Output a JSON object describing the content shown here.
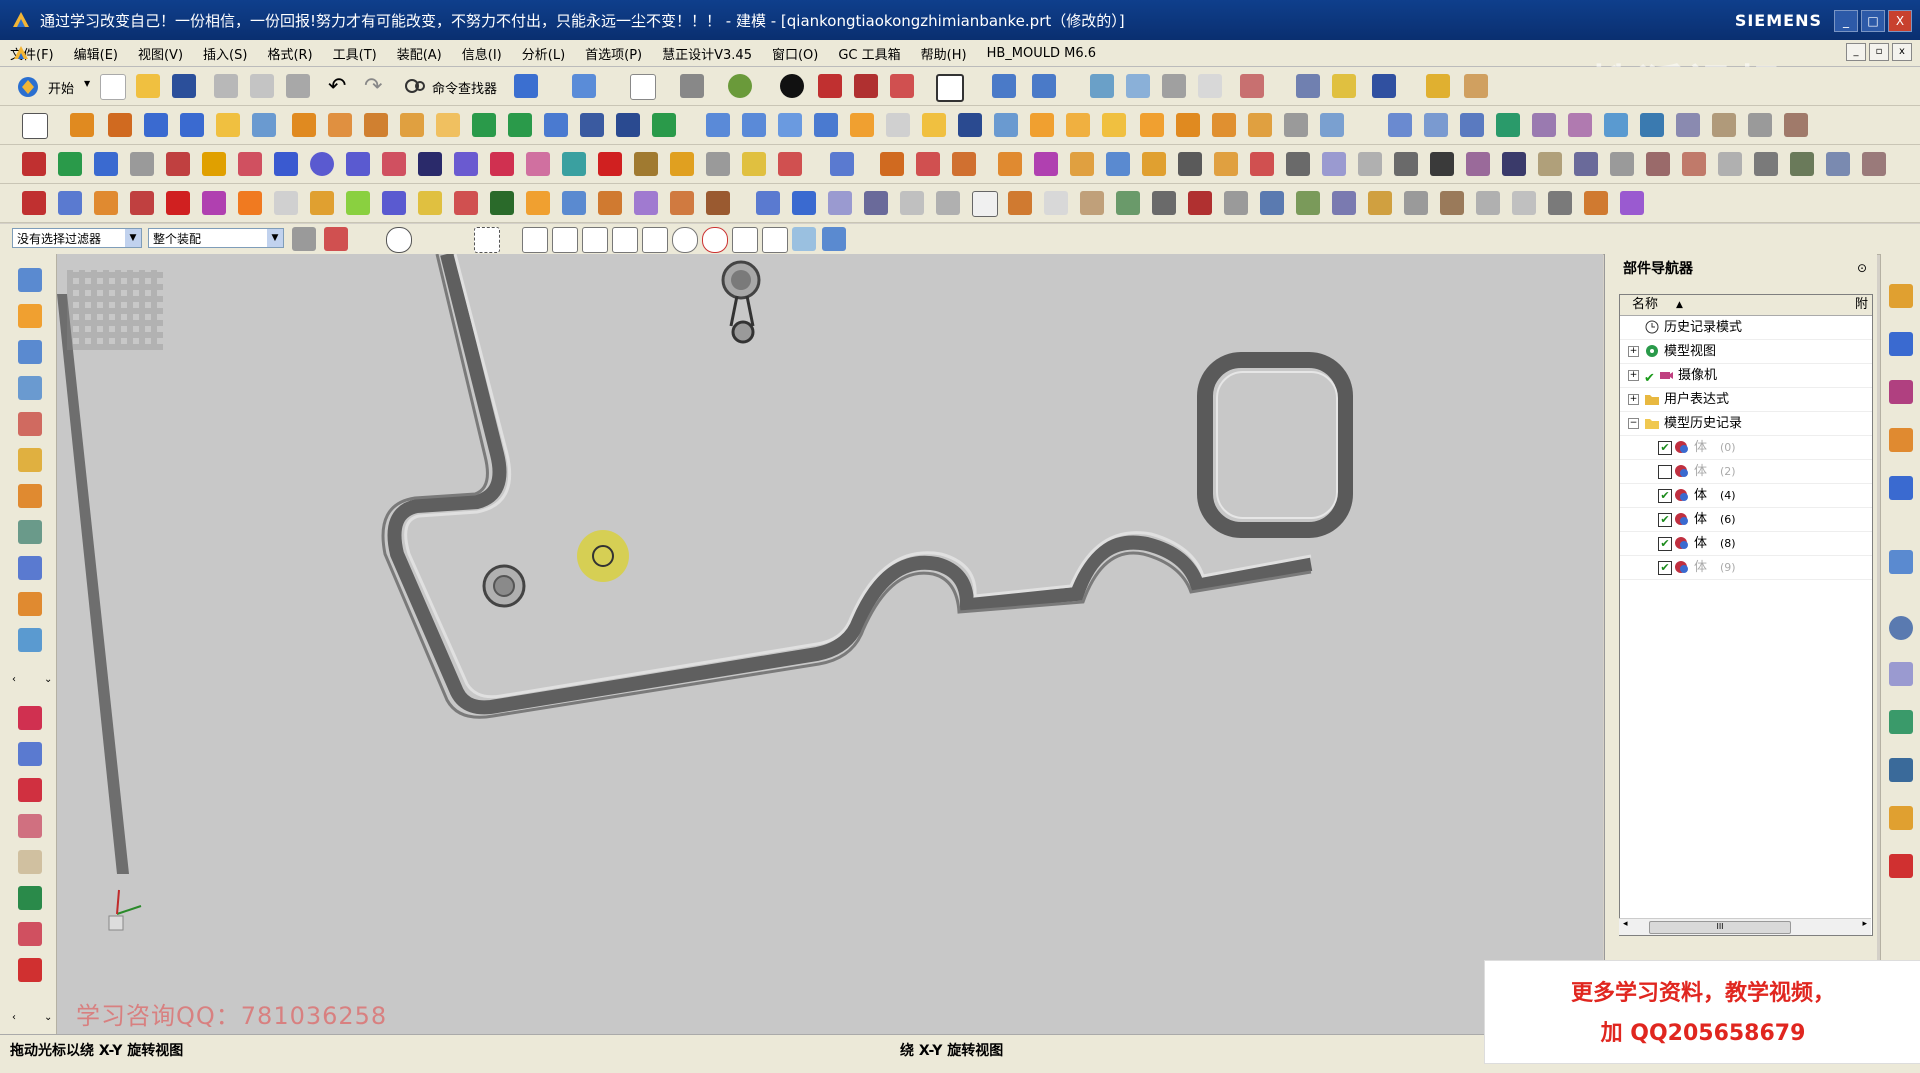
{
  "window": {
    "title": "通过学习改变自己！一份相信，一份回报!努力才有可能改变，不努力不付出，只能永远一尘不变！！！ - 建模 - [qiankongtiaokongzhimianbanke.prt（修改的）]",
    "brand": "SIEMENS",
    "buttons": [
      "_",
      "□",
      "X"
    ]
  },
  "menu": {
    "items": [
      "文件(F)",
      "编辑(E)",
      "视图(V)",
      "插入(S)",
      "格式(R)",
      "工具(T)",
      "装配(A)",
      "信息(I)",
      "分析(L)",
      "首选项(P)",
      "慧正设计V3.45",
      "窗口(O)",
      "GC 工具箱",
      "帮助(H)",
      "HB_MOULD M6.6"
    ]
  },
  "toolbar": {
    "start_label": "开始",
    "command_finder_label": "命令查找器"
  },
  "filters": {
    "selection_filter": "没有选择过滤器",
    "scope": "整个装配"
  },
  "navigator": {
    "title": "部件导航器",
    "col_name": "名称",
    "col_dep": "附",
    "nodes": [
      {
        "label": "历史记录模式",
        "icon": "clock-icon",
        "expandable": false
      },
      {
        "label": "模型视图",
        "icon": "model-view-icon",
        "expandable": true
      },
      {
        "label": "摄像机",
        "icon": "camera-icon",
        "expandable": true
      },
      {
        "label": "用户表达式",
        "icon": "folder-icon",
        "expandable": true
      },
      {
        "label": "模型历史记录",
        "icon": "folder-open-icon",
        "expandable": true
      }
    ],
    "bodies": [
      {
        "label": "体",
        "index": "(0)",
        "checked": true,
        "dim": true
      },
      {
        "label": "体",
        "index": "(2)",
        "checked": false,
        "dim": true
      },
      {
        "label": "体",
        "index": "(4)",
        "checked": true,
        "dim": false
      },
      {
        "label": "体",
        "index": "(6)",
        "checked": true,
        "dim": false
      },
      {
        "label": "体",
        "index": "(8)",
        "checked": true,
        "dim": false
      },
      {
        "label": "体",
        "index": "(9)",
        "checked": true,
        "dim": true
      }
    ],
    "scroll_glyph": "III"
  },
  "status": {
    "left": "拖动光标以绕 X-Y 旋转视图",
    "center": "绕 X-Y 旋转视图"
  },
  "overlays": {
    "ad_line1": "更多学习资料，教学视频，",
    "ad_line2": "加 QQ205658679",
    "qq_watermark": "学习咨询QQ：781036258",
    "sohu_watermark": "搜狐视频"
  },
  "colors": {
    "titlebar": "#0f3f8c",
    "viewport_bg": "#c8c8c8",
    "ad_text": "#e0261f"
  }
}
